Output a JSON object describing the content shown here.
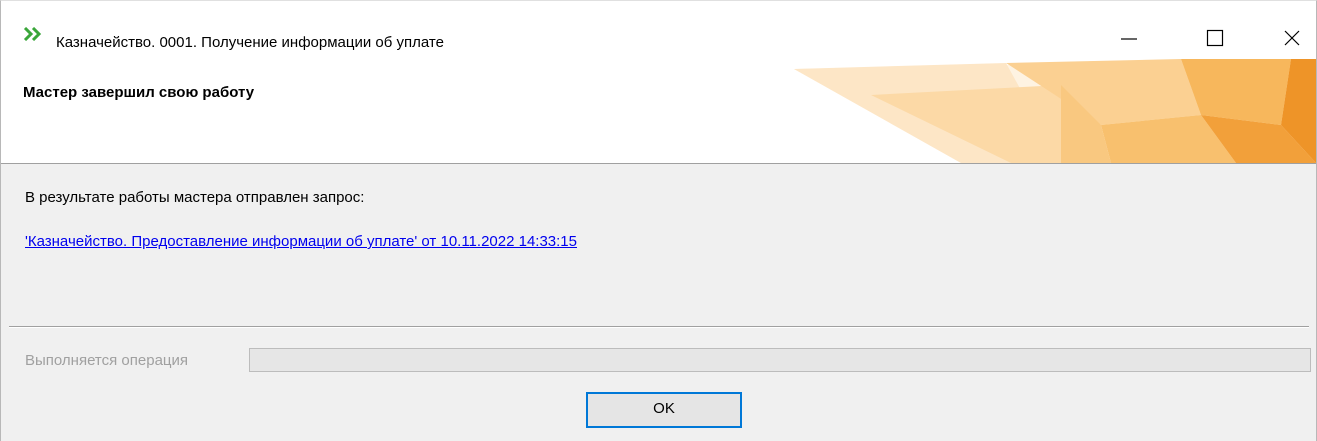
{
  "window": {
    "title": "Казначейство. 0001. Получение информации об уплате",
    "icon": "double-chevron-right-icon",
    "controls": {
      "minimize": "minimize-icon",
      "maximize": "maximize-icon",
      "close": "close-icon"
    }
  },
  "header": {
    "title": "Мастер завершил свою работу",
    "art_colors": [
      "#fde9cc",
      "#fcd9a6",
      "#f9c67c",
      "#f6b355",
      "#f19a2a",
      "#ea8a1f"
    ]
  },
  "content": {
    "message": "В результате работы мастера отправлен запрос:",
    "link_text": "'Казначейство. Предоставление информации об уплате' от 10.11.2022 14:33:15"
  },
  "footer": {
    "progress_label": "Выполняется операция",
    "progress_value": 0,
    "ok_label": "OK"
  },
  "colors": {
    "accent": "#0078d7",
    "link": "#0000ee",
    "disabled_text": "#a0a0a0",
    "icon_green": "#3aa63a"
  }
}
